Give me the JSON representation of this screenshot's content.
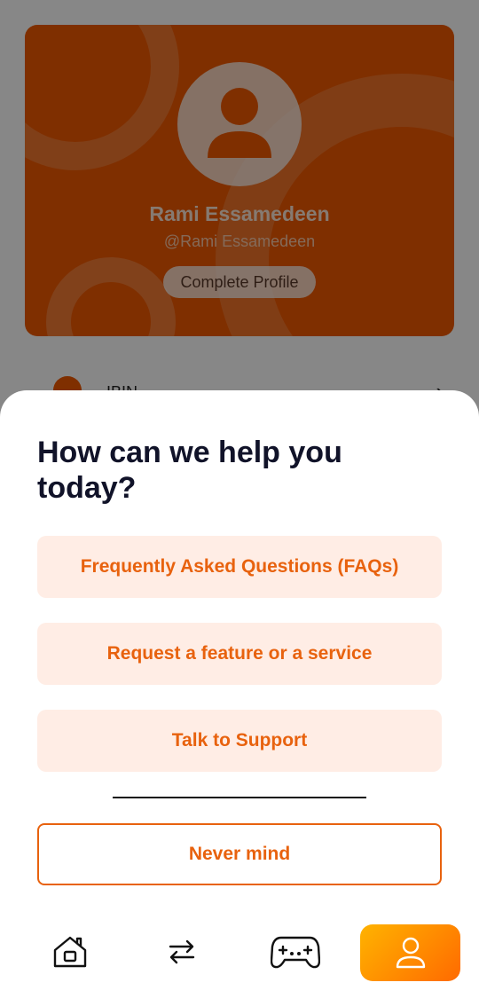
{
  "profile": {
    "name": "Rami Essamedeen",
    "handle": "@Rami Essamedeen",
    "complete_profile_label": "Complete Profile",
    "row_label": "IBIN"
  },
  "sheet": {
    "title": "How can we help you today?",
    "options": [
      {
        "label": "Frequently Asked Questions (FAQs)"
      },
      {
        "label": "Request a feature or a service"
      },
      {
        "label": "Talk to Support"
      }
    ],
    "dismiss_label": "Never mind"
  },
  "nav": {
    "items": [
      {
        "icon": "home-icon"
      },
      {
        "icon": "transfer-icon"
      },
      {
        "icon": "gamepad-icon"
      },
      {
        "icon": "user-icon",
        "active": true
      }
    ]
  },
  "colors": {
    "accent": "#E8620E",
    "card": "#F05A00",
    "button_bg": "#FFEDE5",
    "title": "#111329"
  }
}
